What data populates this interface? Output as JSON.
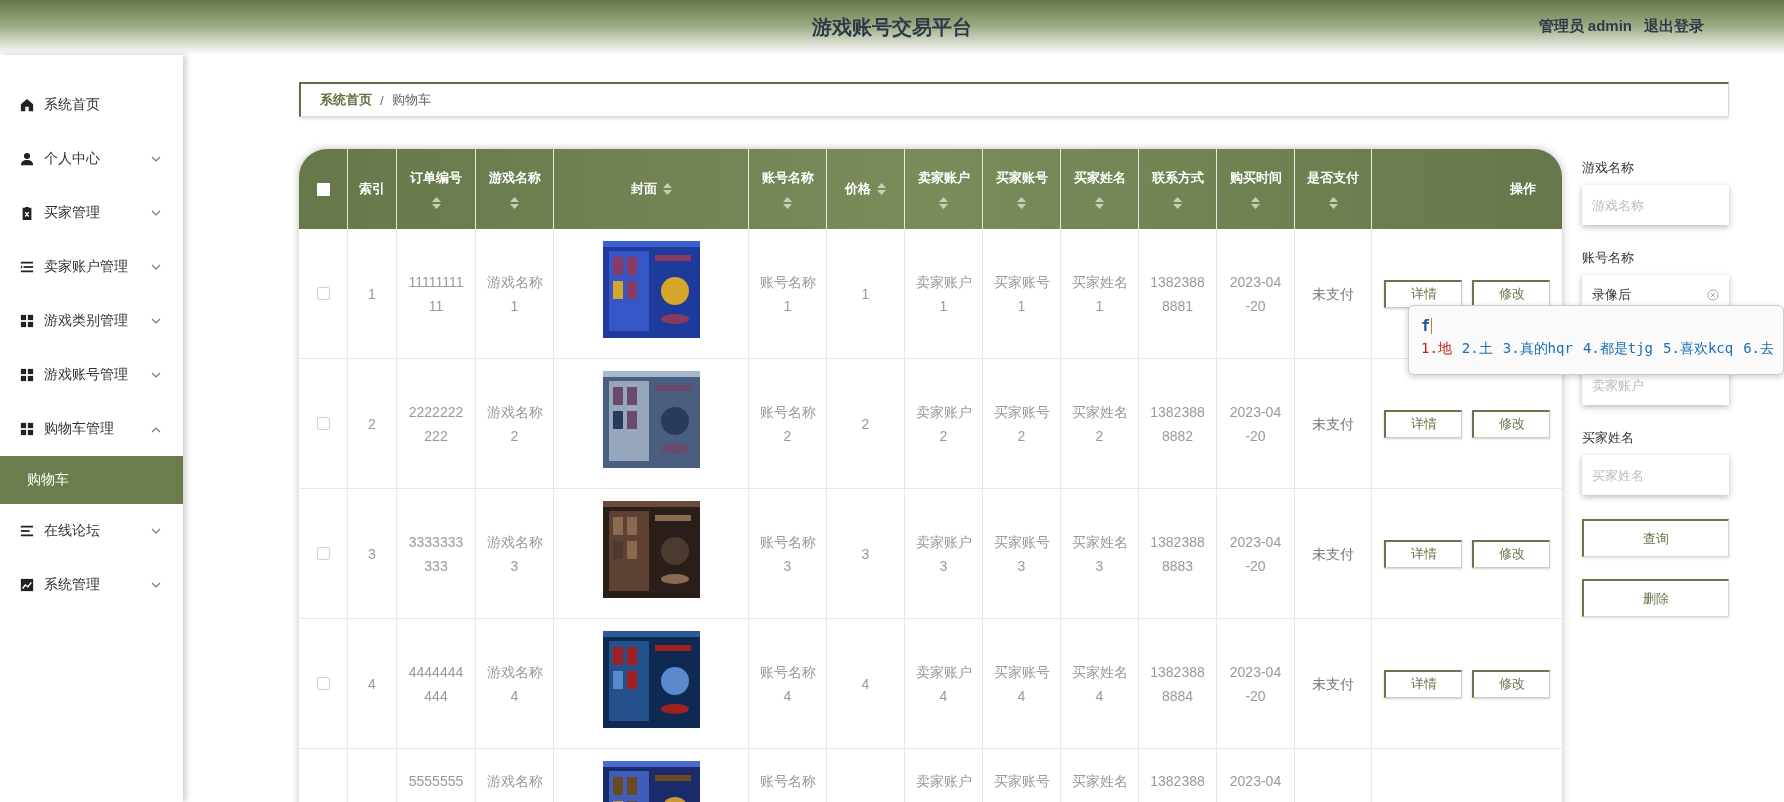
{
  "header": {
    "title": "游戏账号交易平台",
    "user": "管理员 admin",
    "logout": "退出登录"
  },
  "sidebar": {
    "items": [
      {
        "label": "系统首页",
        "kind": "link"
      },
      {
        "label": "个人中心",
        "kind": "menu",
        "expanded": false
      },
      {
        "label": "买家管理",
        "kind": "menu",
        "expanded": false
      },
      {
        "label": "卖家账户管理",
        "kind": "menu",
        "expanded": false
      },
      {
        "label": "游戏类别管理",
        "kind": "menu",
        "expanded": false
      },
      {
        "label": "游戏账号管理",
        "kind": "menu",
        "expanded": false
      },
      {
        "label": "购物车管理",
        "kind": "menu",
        "expanded": true,
        "children": [
          {
            "label": "购物车",
            "selected": true
          }
        ]
      },
      {
        "label": "在线论坛",
        "kind": "menu",
        "expanded": false
      },
      {
        "label": "系统管理",
        "kind": "menu",
        "expanded": false
      }
    ]
  },
  "breadcrumb": [
    "系统首页",
    "/",
    "购物车"
  ],
  "table": {
    "select_all": {
      "checked": false
    },
    "columns": [
      {
        "label": "索引",
        "kind": "plain"
      },
      {
        "label": "订单编号",
        "kind": "sort_below"
      },
      {
        "label": "游戏名称",
        "kind": "sort_below"
      },
      {
        "label": "封面",
        "kind": "sort_inline"
      },
      {
        "label": "账号名称",
        "kind": "sort_below"
      },
      {
        "label": "价格",
        "kind": "sort_inline"
      },
      {
        "label": "卖家账户",
        "kind": "sort_below"
      },
      {
        "label": "买家账号",
        "kind": "sort_below"
      },
      {
        "label": "买家姓名",
        "kind": "sort_below"
      },
      {
        "label": "联系方式",
        "kind": "sort_below"
      },
      {
        "label": "购买时间",
        "kind": "sort_below"
      },
      {
        "label": "是否支付",
        "kind": "sort_below"
      },
      {
        "label": "操作",
        "kind": "plain"
      }
    ],
    "rows": [
      {
        "checked": false,
        "index": "1",
        "order_no": "1111111111",
        "game_name": "游戏名称1",
        "account_name": "账号名称1",
        "price": "1",
        "seller_account": "卖家账户1",
        "buyer_account": "买家账号1",
        "buyer_name": "买家姓名1",
        "phone": "13823888881",
        "purchase_time": "2023-04-20",
        "paid": "未支付",
        "actions": [
          "详情",
          "修改"
        ]
      },
      {
        "checked": false,
        "index": "2",
        "order_no": "2222222222",
        "game_name": "游戏名称2",
        "account_name": "账号名称2",
        "price": "2",
        "seller_account": "卖家账户2",
        "buyer_account": "买家账号2",
        "buyer_name": "买家姓名2",
        "phone": "13823888882",
        "purchase_time": "2023-04-20",
        "paid": "未支付",
        "actions": [
          "详情",
          "修改"
        ]
      },
      {
        "checked": false,
        "index": "3",
        "order_no": "3333333333",
        "game_name": "游戏名称3",
        "account_name": "账号名称3",
        "price": "3",
        "seller_account": "卖家账户3",
        "buyer_account": "买家账号3",
        "buyer_name": "买家姓名3",
        "phone": "13823888883",
        "purchase_time": "2023-04-20",
        "paid": "未支付",
        "actions": [
          "详情",
          "修改"
        ]
      },
      {
        "checked": false,
        "index": "4",
        "order_no": "4444444444",
        "game_name": "游戏名称4",
        "account_name": "账号名称4",
        "price": "4",
        "seller_account": "卖家账户4",
        "buyer_account": "买家账号4",
        "buyer_name": "买家姓名4",
        "phone": "13823888884",
        "purchase_time": "2023-04-20",
        "paid": "未支付",
        "actions": [
          "详情",
          "修改"
        ]
      },
      {
        "order_no": "5555555",
        "game_name": "游戏名称",
        "account_name": "账号名称",
        "seller_account": "卖家账户",
        "buyer_account": "买家账号",
        "buyer_name": "买家姓名",
        "phone": "1382388",
        "purchase_time": "2023-04"
      }
    ]
  },
  "search": {
    "fields": [
      {
        "label": "游戏名称",
        "placeholder": "游戏名称"
      },
      {
        "label": "账号名称",
        "value": "录像后",
        "clearable": true
      },
      {
        "placeholder": "卖家账户"
      },
      {
        "label": "买家姓名",
        "placeholder": "买家姓名"
      }
    ],
    "buttons": [
      "查询",
      "删除"
    ]
  },
  "ime_popup": {
    "composition": "f",
    "candidates": [
      {
        "text": "1.地",
        "selected": true
      },
      {
        "text": "2.土",
        "selected": false
      },
      {
        "text": "3.真的hqr",
        "selected": false
      },
      {
        "text": "4.都是tjg",
        "selected": false
      },
      {
        "text": "5.喜欢kcq",
        "selected": false
      },
      {
        "text": "6.去",
        "selected": false
      }
    ]
  }
}
